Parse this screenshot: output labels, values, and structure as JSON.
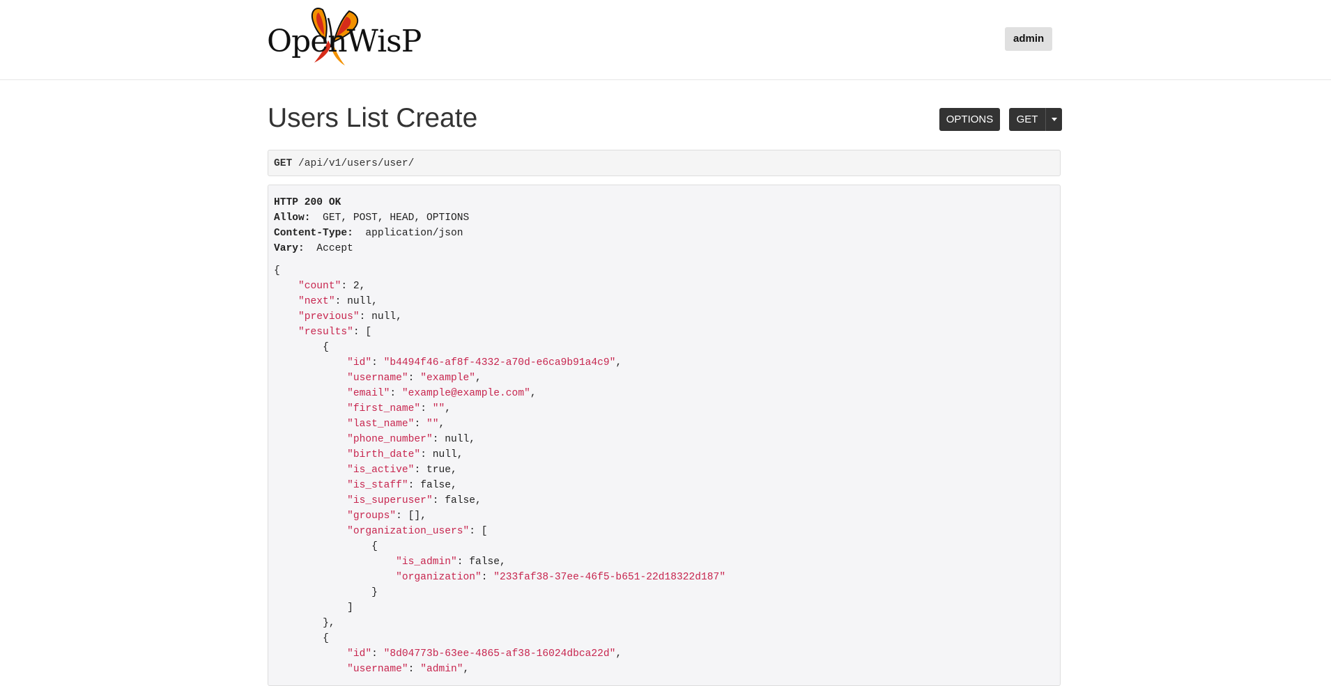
{
  "nav": {
    "logo_text": "OpenWisP",
    "user_button": "admin"
  },
  "page": {
    "title": "Users List Create",
    "options_button": "OPTIONS",
    "get_button": "GET"
  },
  "request": {
    "method": "GET",
    "path": "/api/v1/users/user/"
  },
  "response": {
    "status_line": "HTTP 200 OK",
    "headers": [
      {
        "name": "Allow:",
        "value": "GET, POST, HEAD, OPTIONS"
      },
      {
        "name": "Content-Type:",
        "value": "application/json"
      },
      {
        "name": "Vary:",
        "value": "Accept"
      }
    ],
    "json_lines": [
      {
        "indent": 0,
        "text": "{"
      },
      {
        "indent": 1,
        "key": "\"count\"",
        "sep": ": ",
        "val": "2",
        "tail": ","
      },
      {
        "indent": 1,
        "key": "\"next\"",
        "sep": ": ",
        "val": "null",
        "tail": ","
      },
      {
        "indent": 1,
        "key": "\"previous\"",
        "sep": ": ",
        "val": "null",
        "tail": ","
      },
      {
        "indent": 1,
        "key": "\"results\"",
        "sep": ": ",
        "val": "[",
        "tail": ""
      },
      {
        "indent": 2,
        "text": "{"
      },
      {
        "indent": 3,
        "key": "\"id\"",
        "sep": ": ",
        "str": "\"b4494f46-af8f-4332-a70d-e6ca9b91a4c9\"",
        "tail": ","
      },
      {
        "indent": 3,
        "key": "\"username\"",
        "sep": ": ",
        "str": "\"example\"",
        "tail": ","
      },
      {
        "indent": 3,
        "key": "\"email\"",
        "sep": ": ",
        "str": "\"example@example.com\"",
        "tail": ","
      },
      {
        "indent": 3,
        "key": "\"first_name\"",
        "sep": ": ",
        "str": "\"\"",
        "tail": ","
      },
      {
        "indent": 3,
        "key": "\"last_name\"",
        "sep": ": ",
        "str": "\"\"",
        "tail": ","
      },
      {
        "indent": 3,
        "key": "\"phone_number\"",
        "sep": ": ",
        "val": "null",
        "tail": ","
      },
      {
        "indent": 3,
        "key": "\"birth_date\"",
        "sep": ": ",
        "val": "null",
        "tail": ","
      },
      {
        "indent": 3,
        "key": "\"is_active\"",
        "sep": ": ",
        "val": "true",
        "tail": ","
      },
      {
        "indent": 3,
        "key": "\"is_staff\"",
        "sep": ": ",
        "val": "false",
        "tail": ","
      },
      {
        "indent": 3,
        "key": "\"is_superuser\"",
        "sep": ": ",
        "val": "false",
        "tail": ","
      },
      {
        "indent": 3,
        "key": "\"groups\"",
        "sep": ": ",
        "val": "[]",
        "tail": ","
      },
      {
        "indent": 3,
        "key": "\"organization_users\"",
        "sep": ": ",
        "val": "[",
        "tail": ""
      },
      {
        "indent": 4,
        "text": "{"
      },
      {
        "indent": 5,
        "key": "\"is_admin\"",
        "sep": ": ",
        "val": "false",
        "tail": ","
      },
      {
        "indent": 5,
        "key": "\"organization\"",
        "sep": ": ",
        "str": "\"233faf38-37ee-46f5-b651-22d18322d187\"",
        "tail": ""
      },
      {
        "indent": 4,
        "text": "}"
      },
      {
        "indent": 3,
        "text": "]"
      },
      {
        "indent": 2,
        "text": "},"
      },
      {
        "indent": 2,
        "text": "{"
      },
      {
        "indent": 3,
        "key": "\"id\"",
        "sep": ": ",
        "str": "\"8d04773b-63ee-4865-af38-16024dbca22d\"",
        "tail": ","
      },
      {
        "indent": 3,
        "key": "\"username\"",
        "sep": ": ",
        "str": "\"admin\"",
        "tail": ","
      }
    ]
  }
}
